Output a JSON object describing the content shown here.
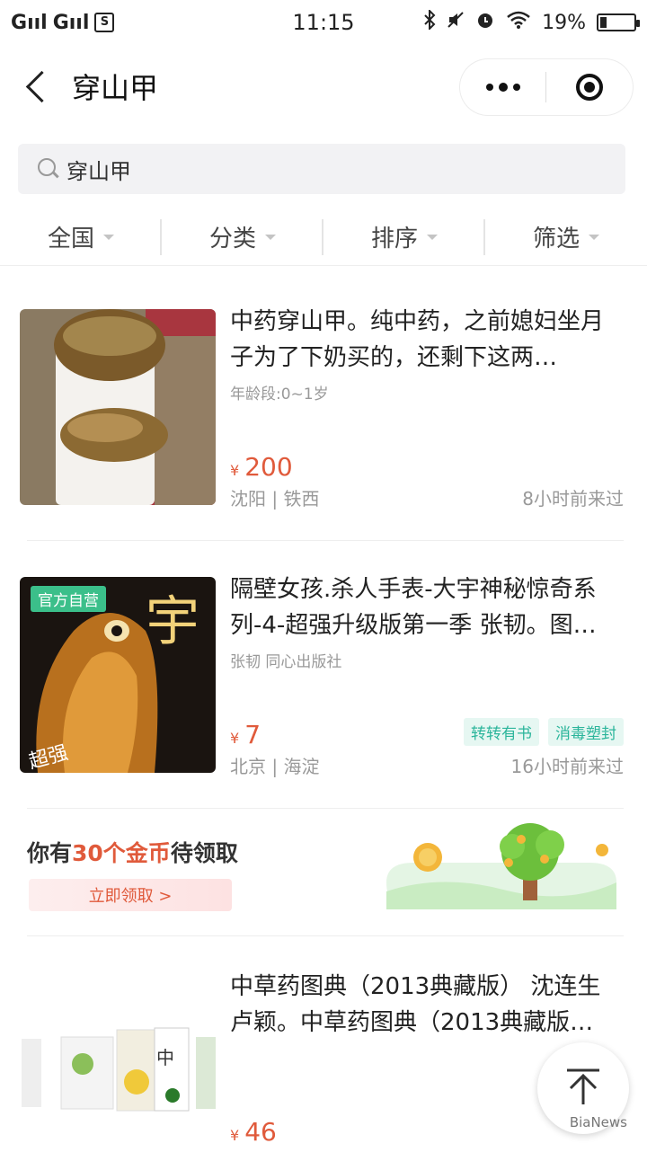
{
  "status_bar": {
    "signal_left": "G",
    "signal_right": "G",
    "s_badge": "S",
    "time": "11:15",
    "battery": "19%",
    "battery_level": 0.19
  },
  "nav": {
    "title": "穿山甲"
  },
  "search": {
    "value": "穿山甲"
  },
  "filters": [
    {
      "label": "全国"
    },
    {
      "label": "分类"
    },
    {
      "label": "排序"
    },
    {
      "label": "筛选"
    }
  ],
  "items": [
    {
      "title": "中药穿山甲。纯中药，之前媳妇坐月子为了下奶买的，还剩下这两…",
      "sub": "年龄段:0~1岁",
      "price_symbol": "¥",
      "price": "200",
      "location": "沈阳 | 铁西",
      "time": "8小时前来过",
      "tags": []
    },
    {
      "title": "隔壁女孩.杀人手表-大宇神秘惊奇系列-4-超强升级版第一季 张韧。图…",
      "sub": "张韧 同心出版社",
      "badge": "官方自营",
      "price_symbol": "¥",
      "price": "7",
      "location": "北京 | 海淀",
      "time": "16小时前来过",
      "tags": [
        "转转有书",
        "消毒塑封"
      ]
    },
    {
      "title": "中草药图典（2013典藏版） 沈连生 卢颖。中草药图典（2013典藏版…",
      "price_symbol": "¥",
      "price": "46"
    }
  ],
  "coins": {
    "prefix": "你有",
    "highlight": "30个金币",
    "suffix": "待领取",
    "button": "立即领取 >"
  },
  "watermark": "BiaNews",
  "colors": {
    "price": "#e05a3b",
    "tag": "#2bb59b"
  }
}
